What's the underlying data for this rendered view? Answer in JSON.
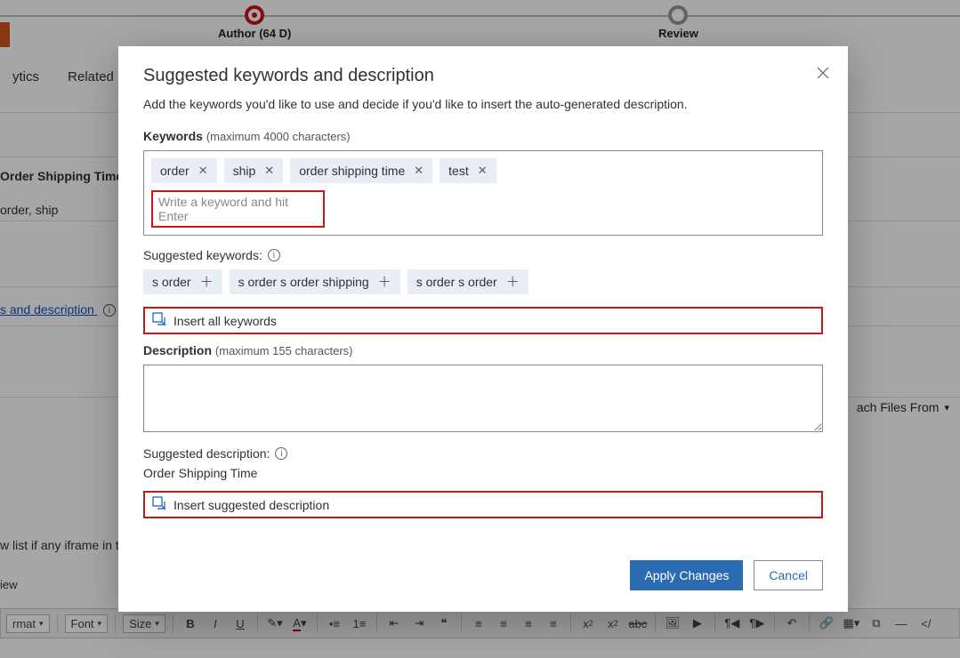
{
  "bg": {
    "step_author": "Author  (64 D)",
    "step_review": "Review",
    "nav_analytics": "ytics",
    "nav_related": "Related",
    "title_field": "Order Shipping Time",
    "keywords_field": "order, ship",
    "link_text": "s and description",
    "attach_label": "ach Files From",
    "allow_text": "w list if any iframe in t",
    "view_text": "iew",
    "tb_format": "rmat",
    "tb_font": "Font",
    "tb_size": "Size"
  },
  "modal": {
    "title": "Suggested keywords and description",
    "subtitle": "Add the keywords you'd like to use and decide if you'd like to insert the auto-generated description.",
    "kw_label": "Keywords",
    "kw_limit": "(maximum 4000 characters)",
    "chips": [
      "order",
      "ship",
      "order shipping time",
      "test"
    ],
    "kw_placeholder": "Write a keyword and hit Enter",
    "sugg_kw_label": "Suggested keywords:",
    "sugg_chips": [
      "s order",
      "s order s order shipping",
      "s order s order"
    ],
    "insert_all": "Insert all keywords",
    "desc_label": "Description",
    "desc_limit": "(maximum 155 characters)",
    "sugg_desc_label": "Suggested description:",
    "sugg_desc_value": "Order Shipping Time",
    "insert_desc": "Insert suggested description",
    "apply": "Apply Changes",
    "cancel": "Cancel"
  }
}
